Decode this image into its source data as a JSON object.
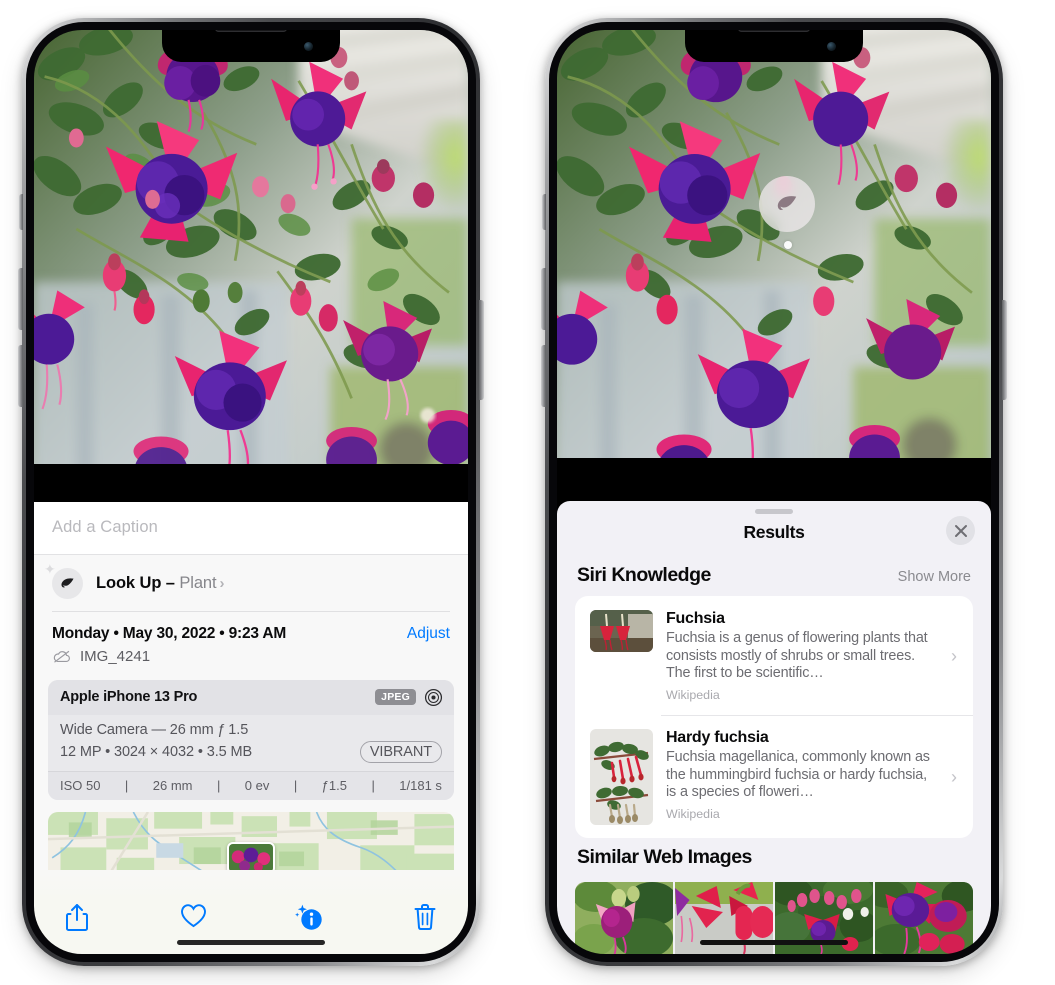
{
  "left_phone": {
    "caption": {
      "placeholder": "Add a Caption",
      "value": ""
    },
    "lookup": {
      "label": "Look Up – ",
      "subject": "Plant",
      "chevron": "›",
      "icon": "leaf-icon"
    },
    "metadata": {
      "date": "Monday • May 30, 2022 • 9:23 AM",
      "adjust": "Adjust",
      "filename": "IMG_4241",
      "cloud_icon": "icloud-slash-icon"
    },
    "exif": {
      "device": "Apple iPhone 13 Pro",
      "format_badge": "JPEG",
      "aperture_icon": "aperture-icon",
      "lens": "Wide Camera — 26 mm ƒ 1.5",
      "size_line": "12 MP • 3024 × 4032 • 3.5 MB",
      "style_badge": "VIBRANT",
      "stats": [
        "ISO 50",
        "26 mm",
        "0 ev",
        "ƒ1.5",
        "1/181 s"
      ]
    },
    "toolbar": [
      {
        "name": "share-button",
        "icon": "share-icon"
      },
      {
        "name": "favorite-button",
        "icon": "heart-icon"
      },
      {
        "name": "info-button",
        "icon": "info-sparkle-icon"
      },
      {
        "name": "delete-button",
        "icon": "trash-icon"
      }
    ]
  },
  "right_phone": {
    "badge": {
      "icon": "leaf-icon"
    },
    "sheet": {
      "title": "Results",
      "close_icon": "close-icon"
    },
    "siri_knowledge": {
      "title": "Siri Knowledge",
      "show_more": "Show More",
      "items": [
        {
          "title": "Fuchsia",
          "description": "Fuchsia is a genus of flowering plants that consists mostly of shrubs or small trees. The first to be scientific…",
          "source": "Wikipedia",
          "chevron": "›"
        },
        {
          "title": "Hardy fuchsia",
          "description": "Fuchsia magellanica, commonly known as the hummingbird fuchsia or hardy fuchsia, is a species of floweri…",
          "source": "Wikipedia",
          "chevron": "›"
        }
      ]
    },
    "similar_web_images": {
      "title": "Similar Web Images",
      "count": 4
    }
  },
  "colors": {
    "accent_blue": "#007aff",
    "sheet_bg": "#f2f1f6",
    "card_bg": "#ffffff",
    "secondary_text": "#86868b",
    "exif_bg": "#e9e9ec",
    "badge_gray": "#8e8e93"
  }
}
